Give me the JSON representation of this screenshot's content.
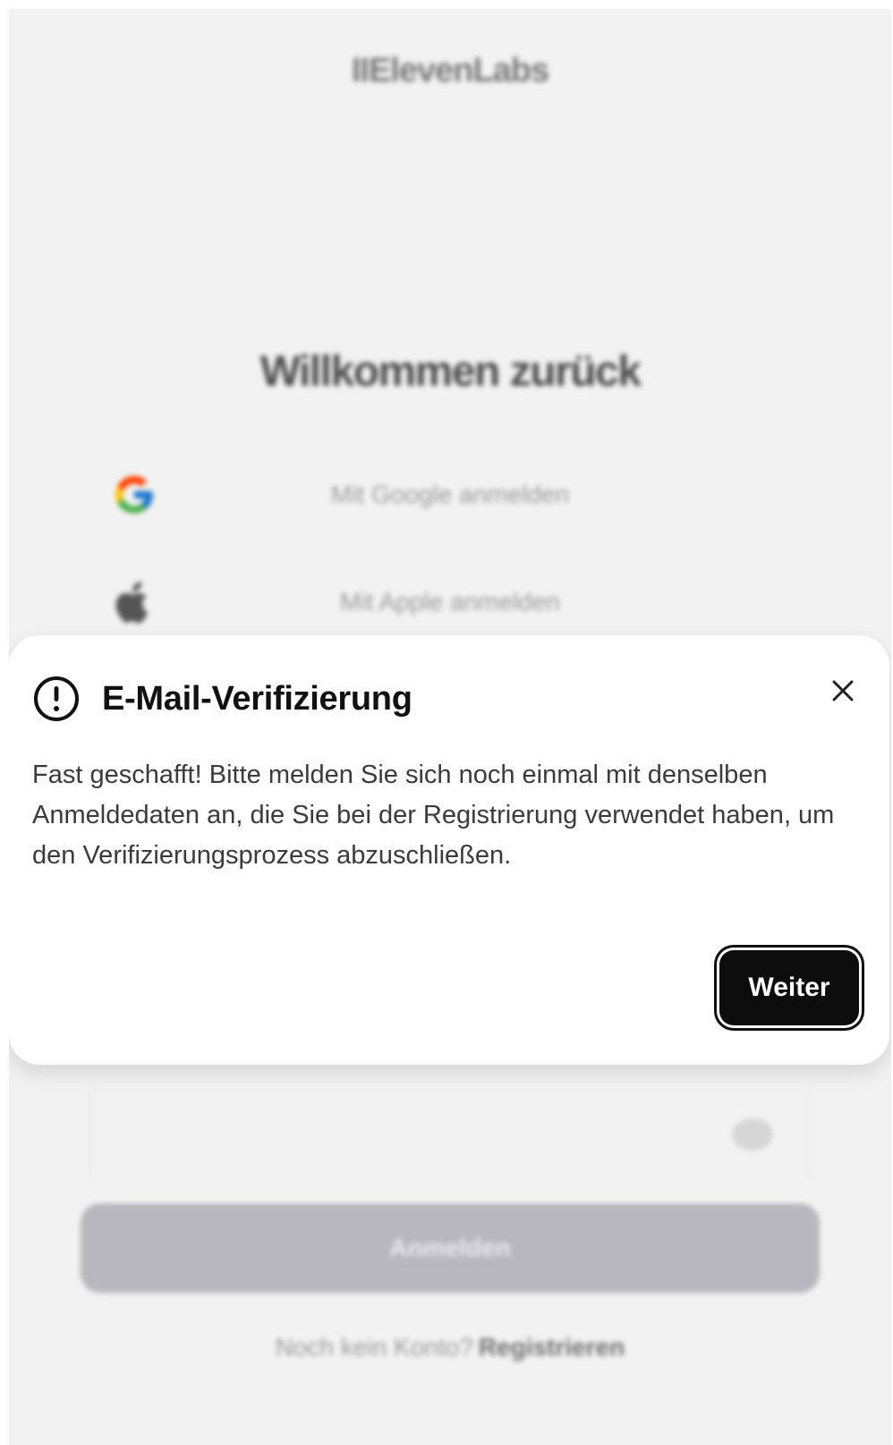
{
  "background_page": {
    "brand": "IIElevenLabs",
    "heading": "Willkommen zurück",
    "oauth_buttons": [
      {
        "icon": "google-icon",
        "label": "Mit Google anmelden"
      },
      {
        "icon": "apple-icon",
        "label": "Mit Apple anmelden"
      }
    ],
    "submit_label": "Anmelden",
    "signup_prompt": "Noch kein Konto?",
    "signup_link": "Registrieren"
  },
  "dialog": {
    "icon": "alert-circle-icon",
    "title": "E-Mail-Verifizierung",
    "close_icon": "close-icon",
    "message": "Fast geschafft! Bitte melden Sie sich noch einmal mit denselben Anmeldedaten an, die Sie bei der Registrierung verwendet haben, um den Verifizierungsprozess abzuschließen.",
    "continue_label": "Weiter"
  },
  "colors": {
    "backdrop": "#f2f2f2",
    "dialog_bg": "#ffffff",
    "primary_button": "#0d0d0d",
    "disabled_button": "#b7b7bd"
  }
}
